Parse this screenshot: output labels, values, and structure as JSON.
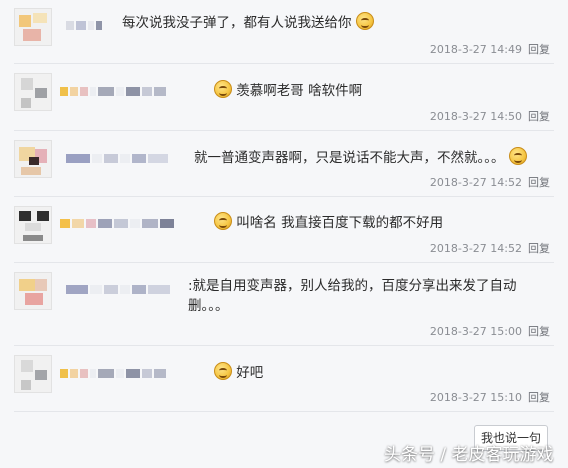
{
  "comments": [
    {
      "text": "每次说我没子弹了，都有人说我送给你",
      "emoji_after": true,
      "time": "2018-3-27 14:49",
      "reply": "回复"
    },
    {
      "text": "羡慕啊老哥 啥软件啊",
      "emoji_before": true,
      "time": "2018-3-27 14:50",
      "reply": "回复"
    },
    {
      "text": "就一普通变声器啊，只是说话不能大声，不然就。。。",
      "emoji_after": true,
      "time": "2018-3-27 14:52",
      "reply": "回复"
    },
    {
      "text": "叫啥名 我直接百度下载的都不好用",
      "emoji_before": true,
      "time": "2018-3-27 14:52",
      "reply": "回复"
    },
    {
      "text": ":就是自用变声器，别人给我的，百度分享出来发了自动删。。。",
      "time": "2018-3-27 15:00",
      "reply": "回复"
    },
    {
      "text": "好吧",
      "emoji_before": true,
      "time": "2018-3-27 15:10",
      "reply": "回复"
    }
  ],
  "post_button": "我也说一句",
  "watermark": "头条号 / 老皮客玩游戏",
  "icons": {
    "emoji": "smiley-emoji-icon"
  }
}
